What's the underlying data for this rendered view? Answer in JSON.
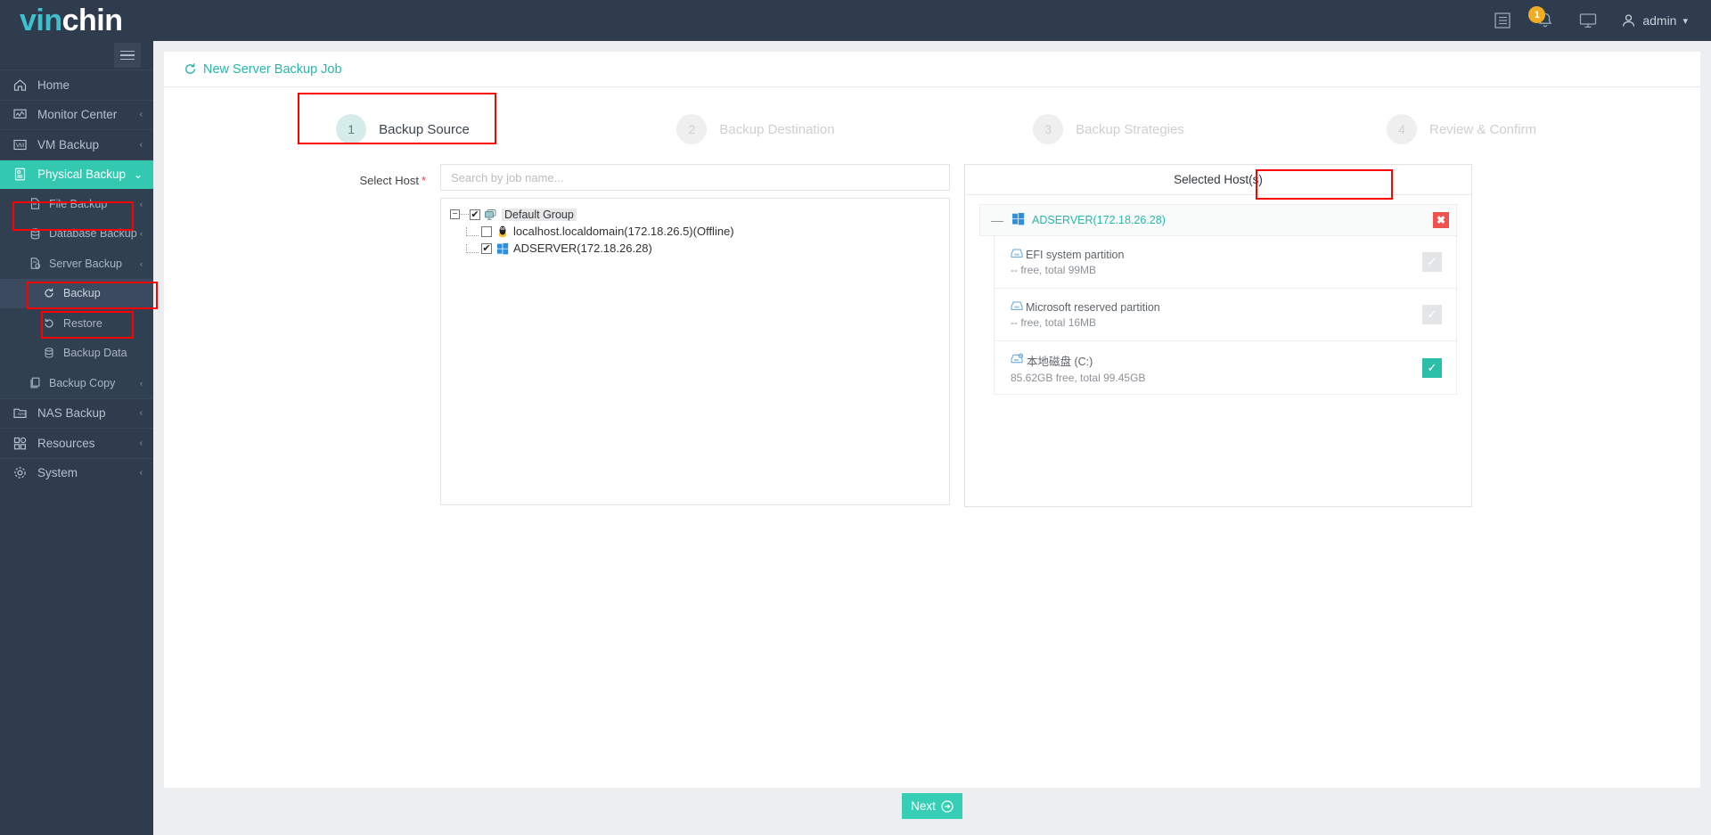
{
  "brand": {
    "part1": "vin",
    "part2": "chin"
  },
  "header": {
    "notification_count": "1",
    "user_label": "admin",
    "icons": [
      "list-icon",
      "bell-icon",
      "monitor-icon",
      "user-icon",
      "chevron-down-icon"
    ]
  },
  "sidebar": {
    "items": [
      {
        "label": "Home",
        "icon": "home-icon",
        "level": 0,
        "chevron": "",
        "active": false
      },
      {
        "label": "Monitor Center",
        "icon": "monitor-chart-icon",
        "level": 0,
        "chevron": "‹",
        "active": false
      },
      {
        "label": "VM Backup",
        "icon": "vm-icon",
        "level": 0,
        "chevron": "‹",
        "active": false
      },
      {
        "label": "Physical Backup",
        "icon": "server-icon",
        "level": 0,
        "chevron": "⌄",
        "active": true
      },
      {
        "label": "File Backup",
        "icon": "file-icon",
        "level": 1,
        "chevron": "‹",
        "active": false
      },
      {
        "label": "Database Backup",
        "icon": "database-icon",
        "level": 1,
        "chevron": "‹",
        "active": false
      },
      {
        "label": "Server Backup",
        "icon": "server-doc-icon",
        "level": 1,
        "chevron": "‹",
        "active": false
      },
      {
        "label": "Backup",
        "icon": "refresh-icon",
        "level": 2,
        "chevron": "",
        "active": false
      },
      {
        "label": "Restore",
        "icon": "restore-icon",
        "level": 2,
        "chevron": "",
        "active": false
      },
      {
        "label": "Backup Data",
        "icon": "database-icon",
        "level": 2,
        "chevron": "",
        "active": false
      },
      {
        "label": "Backup Copy",
        "icon": "copy-icon",
        "level": 1,
        "chevron": "‹",
        "active": false
      },
      {
        "label": "NAS Backup",
        "icon": "nas-icon",
        "level": 0,
        "chevron": "‹",
        "active": false
      },
      {
        "label": "Resources",
        "icon": "grid-icon",
        "level": 0,
        "chevron": "‹",
        "active": false
      },
      {
        "label": "System",
        "icon": "gear-icon",
        "level": 0,
        "chevron": "‹",
        "active": false
      }
    ]
  },
  "page": {
    "title": "New Server Backup Job",
    "steps": [
      {
        "num": "1",
        "label": "Backup Source",
        "state": "on"
      },
      {
        "num": "2",
        "label": "Backup Destination",
        "state": "off"
      },
      {
        "num": "3",
        "label": "Backup Strategies",
        "state": "off"
      },
      {
        "num": "4",
        "label": "Review & Confirm",
        "state": "off"
      }
    ]
  },
  "form": {
    "select_host_label": "Select Host",
    "required_mark": "*",
    "search_placeholder": "Search by job name...",
    "search_value": ""
  },
  "tree": {
    "root": {
      "label": "Default Group",
      "checked": true,
      "expanded": true,
      "icon": "group-screens-icon"
    },
    "children": [
      {
        "label": "localhost.localdomain(172.18.26.5)(Offline)",
        "checked": false,
        "icon": "linux-tux-icon"
      },
      {
        "label": "ADSERVER(172.18.26.28)",
        "checked": true,
        "icon": "windows-icon"
      }
    ]
  },
  "selected": {
    "panel_title": "Selected Host(s)",
    "host": {
      "name": "ADSERVER(172.18.26.28)",
      "icon": "windows-icon",
      "collapse": "—",
      "delete_label": "✖"
    },
    "partitions": [
      {
        "name": "EFI system partition",
        "detail": "-- free, total 99MB",
        "checked": false,
        "icon": "disk-icon"
      },
      {
        "name": "Microsoft reserved partition",
        "detail": "-- free, total 16MB",
        "checked": false,
        "icon": "disk-icon"
      },
      {
        "name": "本地磁盘 (C:)",
        "detail": "85.62GB free, total 99.45GB",
        "checked": true,
        "icon": "local-disk-icon"
      }
    ]
  },
  "footer": {
    "next_label": "Next",
    "next_icon": "arrow-right-circle-icon"
  },
  "colors": {
    "brand_teal": "#33c9b1",
    "sidebar_bg": "#2e3c4e",
    "accent_link": "#27b7a8",
    "highlight_red": "#ff0000",
    "badge_amber": "#f0ad22",
    "delete_red": "#ef5350"
  }
}
